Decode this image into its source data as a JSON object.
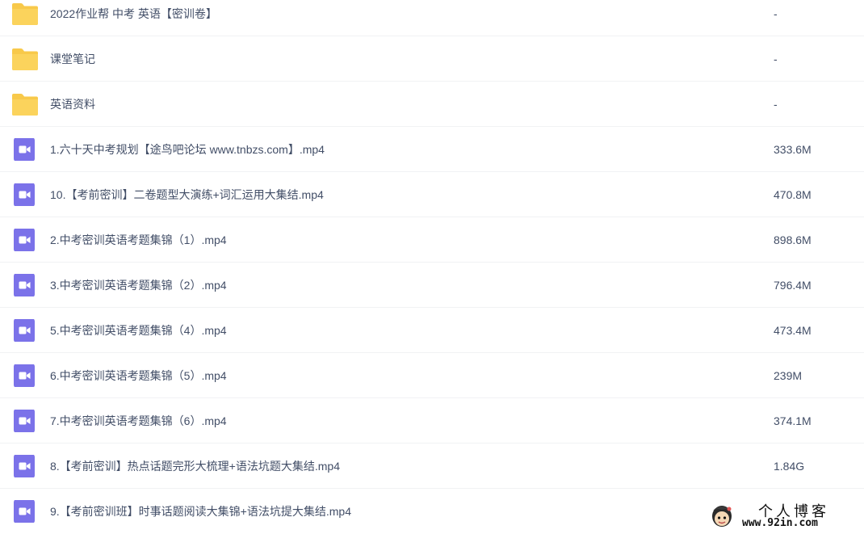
{
  "colors": {
    "folder": "#f8c94a",
    "video": "#7b72e9",
    "text": "#424e67",
    "divider": "#f1f2f4"
  },
  "files": [
    {
      "icon": "folder-icon",
      "name": "2022作业帮 中考 英语【密训卷】",
      "size": "-"
    },
    {
      "icon": "folder-icon",
      "name": "课堂笔记",
      "size": "-"
    },
    {
      "icon": "folder-icon",
      "name": "英语资料",
      "size": "-"
    },
    {
      "icon": "video-file-icon",
      "name": "1.六十天中考规划【途鸟吧论坛 www.tnbzs.com】.mp4",
      "size": "333.6M"
    },
    {
      "icon": "video-file-icon",
      "name": "10.【考前密训】二卷题型大演练+词汇运用大集结.mp4",
      "size": "470.8M"
    },
    {
      "icon": "video-file-icon",
      "name": "2.中考密训英语考题集锦（1）.mp4",
      "size": "898.6M"
    },
    {
      "icon": "video-file-icon",
      "name": "3.中考密训英语考题集锦（2）.mp4",
      "size": "796.4M"
    },
    {
      "icon": "video-file-icon",
      "name": "5.中考密训英语考题集锦（4）.mp4",
      "size": "473.4M"
    },
    {
      "icon": "video-file-icon",
      "name": "6.中考密训英语考题集锦（5）.mp4",
      "size": "239M"
    },
    {
      "icon": "video-file-icon",
      "name": "7.中考密训英语考题集锦（6）.mp4",
      "size": "374.1M"
    },
    {
      "icon": "video-file-icon",
      "name": "8.【考前密训】热点话题完形大梳理+语法坑题大集结.mp4",
      "size": "1.84G"
    },
    {
      "icon": "video-file-icon",
      "name": "9.【考前密训班】时事话题阅读大集锦+语法坑提大集结.mp4",
      "size": ""
    }
  ],
  "watermark": {
    "title": "个人博客",
    "url": "www.92in.com"
  }
}
